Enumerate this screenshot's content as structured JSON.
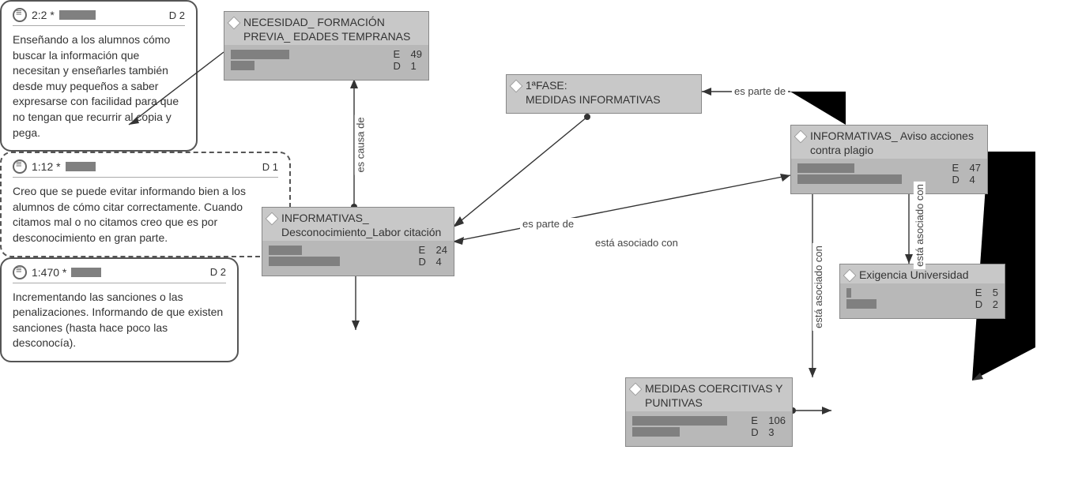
{
  "codes": {
    "necesidad": {
      "title": "NECESIDAD_ FORMACIÓN PREVIA_ EDADES TEMPRANAS",
      "E": "49",
      "D": "1",
      "bar1": 74,
      "bar2": 30
    },
    "fase1": {
      "title": "1ªFASE:\nMEDIDAS INFORMATIVAS"
    },
    "inf_desconoc": {
      "title": "INFORMATIVAS_ Desconocimiento_Labor citación",
      "E": "24",
      "D": "4",
      "bar1": 42,
      "bar2": 90
    },
    "inf_aviso": {
      "title": "INFORMATIVAS_ Aviso acciones contra plagio",
      "E": "47",
      "D": "4",
      "bar1": 72,
      "bar2": 132
    },
    "exigencia": {
      "title": "Exigencia Universidad",
      "E": "5",
      "D": "2",
      "bar1": 6,
      "bar2": 38
    },
    "coercitivas": {
      "title": "MEDIDAS COERCITIVAS Y PUNITIVAS",
      "E": "106",
      "D": "3",
      "bar1": 120,
      "bar2": 60
    }
  },
  "quotes": {
    "q22": {
      "title": "2:2 *",
      "D": "D  2",
      "text": "Enseñando a los alumnos cómo buscar la información que necesitan y enseñarles también desde muy pequeños a saber expresarse con facilidad para que no tengan que recurrir al copia y pega."
    },
    "q112": {
      "title": "1:12 *",
      "D": "D  1",
      "text": "Creo que se puede evitar informando bien a los alumnos de cómo citar correctamente. Cuando citamos mal o no citamos creo que es por desconocimiento en gran parte."
    },
    "q1470": {
      "title": "1:470 *",
      "D": "D  2",
      "text": "Incrementando las sanciones o las penalizaciones. Informando de que existen sanciones (hasta hace poco las desconocía)."
    }
  },
  "edges": {
    "es_causa": "es causa de",
    "es_parte": "es parte de",
    "asociado": "está asociado con"
  }
}
